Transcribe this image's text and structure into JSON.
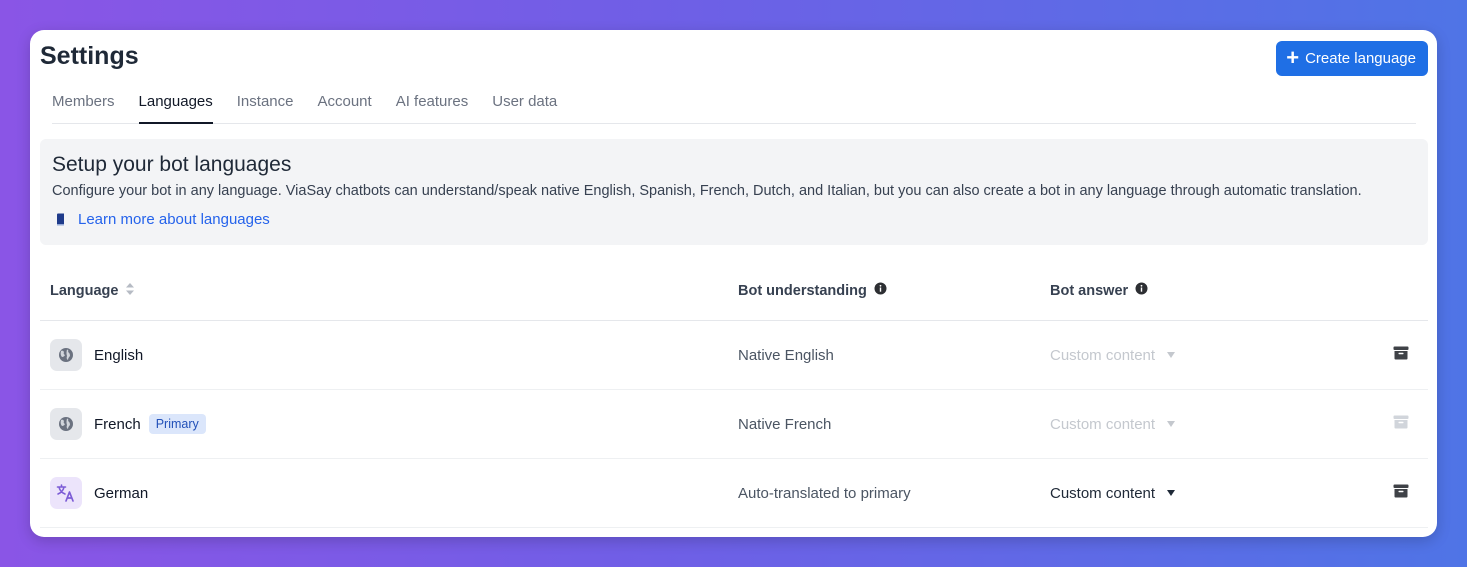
{
  "header": {
    "title": "Settings",
    "create_button": {
      "icon": "plus-icon",
      "label": "Create language"
    }
  },
  "tabs": [
    {
      "label": "Members",
      "active": false
    },
    {
      "label": "Languages",
      "active": true
    },
    {
      "label": "Instance",
      "active": false
    },
    {
      "label": "Account",
      "active": false
    },
    {
      "label": "AI features",
      "active": false
    },
    {
      "label": "User data",
      "active": false
    }
  ],
  "info": {
    "title": "Setup your bot languages",
    "description": "Configure your bot in any language. ViaSay chatbots can understand/speak native English, Spanish, French, Dutch, and Italian, but you can also create a bot in any language through automatic translation.",
    "link": {
      "icon": "book-icon",
      "label": "Learn more about languages"
    }
  },
  "table": {
    "columns": {
      "language": "Language",
      "understanding": "Bot understanding",
      "answer": "Bot answer"
    },
    "rows": [
      {
        "icon": "globe-icon",
        "language": "English",
        "badge": "",
        "understanding": "Native English",
        "answer": "Custom content",
        "answer_enabled": false,
        "archive_enabled": true
      },
      {
        "icon": "globe-icon",
        "language": "French",
        "badge": "Primary",
        "understanding": "Native French",
        "answer": "Custom content",
        "answer_enabled": false,
        "archive_enabled": false
      },
      {
        "icon": "translate-icon",
        "language": "German",
        "badge": "",
        "understanding": "Auto-translated to primary",
        "answer": "Custom content",
        "answer_enabled": true,
        "archive_enabled": true
      }
    ]
  },
  "colors": {
    "accent": "#1f6fe5",
    "link": "#2563eb",
    "badge_bg": "#dbe6fb",
    "badge_text": "#2150b8",
    "translate_icon": "#7c5cd6"
  }
}
